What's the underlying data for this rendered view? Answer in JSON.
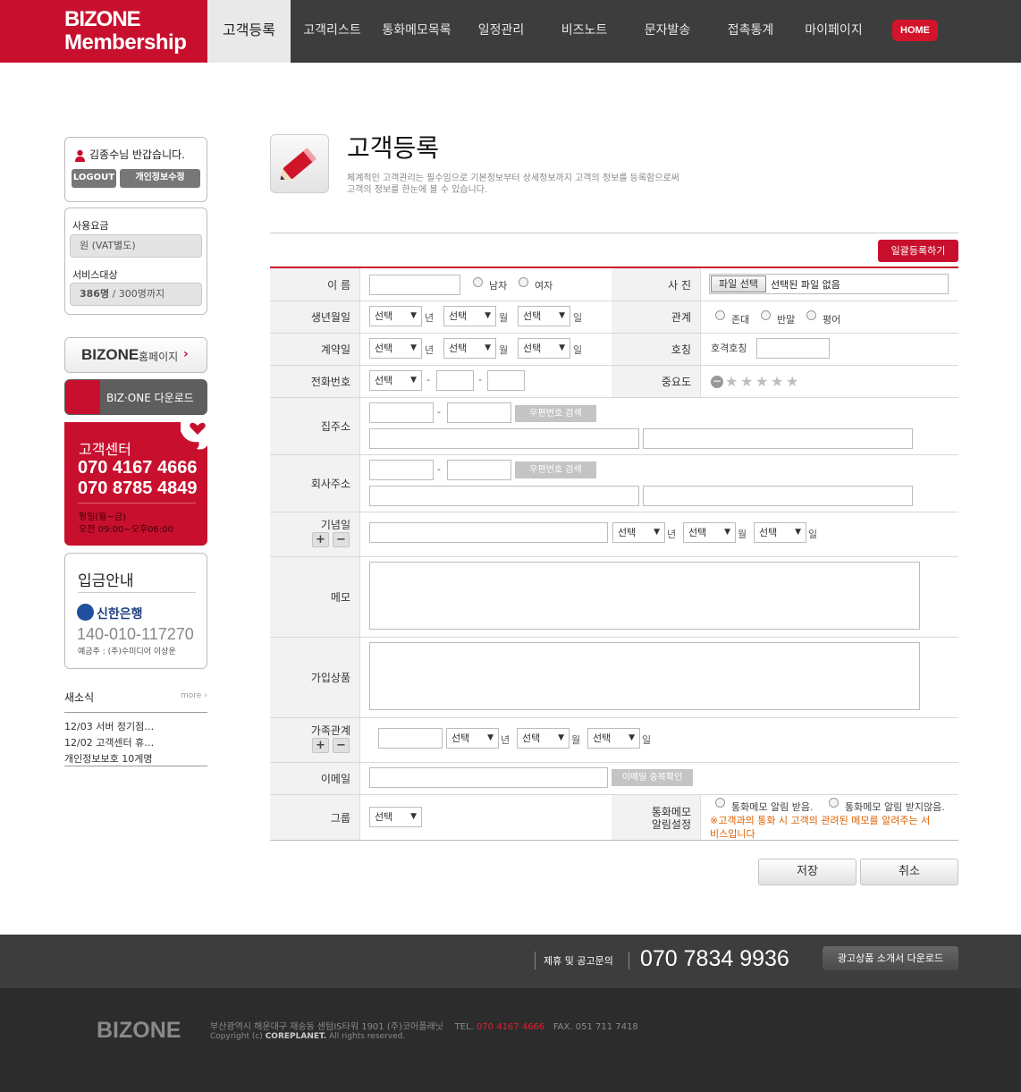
{
  "brand": {
    "logo_top": "BIZONE",
    "logo_bottom": "Membership"
  },
  "nav": {
    "items": [
      "고객등록",
      "고객리스트",
      "통화메모목록",
      "일정관리",
      "비즈노트",
      "문자발송",
      "접촉통계",
      "마이페이지"
    ],
    "home": "HOME"
  },
  "sidebar": {
    "greeting": "김종수님 반갑습니다.",
    "logout": "LOGOUT",
    "edit_profile": "개인정보수정",
    "fee_label": "사용요금",
    "fee_value": "원 (VAT별도)",
    "target_label": "서비스대상",
    "target_count": "386명",
    "target_max": "/ 300명까지",
    "homepage_logo": "BIZONE",
    "homepage_label": "홈페이지",
    "download_label": "BIZ·ONE 다운로드",
    "cc_title": "고객센터",
    "cc_phone1": "070 4167 4666",
    "cc_phone2": "070 8785 4849",
    "cc_hours1": "평일(월~금)",
    "cc_hours2": "오전 09:00~오후06:00",
    "deposit_title": "입금안내",
    "bank_name": "신한은행",
    "account": "140-010-117270",
    "holder": "예금주 : (주)수미디어 이상운",
    "news_title": "새소식",
    "news_more": "more",
    "news": [
      "12/03 서버 정기점…",
      "12/02 고객센터 휴…",
      "개인정보보호 10계명"
    ]
  },
  "page": {
    "title": "고객등록",
    "desc1": "체계적인 고객관리는 필수임으로 기본정보부터 상세정보까지 고객의 정보를 등록함으로써",
    "desc2": "고객의 정보를 한눈에 볼 수 있습니다.",
    "bulk_button": "일괄등록하기"
  },
  "form": {
    "name": "이 름",
    "male": "남자",
    "female": "여자",
    "photo": "사 진",
    "file_button": "파일 선택",
    "file_none": "선택된 파일 없음",
    "birth": "생년월일",
    "select": "선택",
    "year": "년",
    "month": "월",
    "day": "일",
    "relation": "관계",
    "rel1": "존대",
    "rel2": "반말",
    "rel3": "평어",
    "contract": "계약일",
    "title_lbl": "호칭",
    "title_ph": "호격호칭",
    "phone": "전화번호",
    "dash": "-",
    "importance": "중요도",
    "home_addr": "집주소",
    "zip_search": "우편번호 검색",
    "office_addr": "회사주소",
    "anniversary": "기념일",
    "memo": "메모",
    "products": "가입상품",
    "family": "가족관계",
    "email": "이메일",
    "email_check": "이메일 중복확인",
    "group": "그룹",
    "call_memo1": "통화메모",
    "call_memo2": "알림설정",
    "call_opt1": "통화메모 알림 받음.",
    "call_opt2": "통화메모 알림 받지않음.",
    "call_note1": "※고객과의 통화 시 고객의 관려된 메모를 알려주는 서",
    "call_note2": "비스입니다",
    "save": "저장",
    "cancel": "취소"
  },
  "footer": {
    "partner": "제휴 및 공고문의",
    "phone": "070 7834 9936",
    "ad_download": "광고상품 소개서 다운로드",
    "logo": "BIZONE",
    "address": "부산광역시 해운대구 재송동 센텀IS타워 1901 (주)코어플래닛",
    "tel_label": "TEL.",
    "tel": "070 4167 4666",
    "fax": "FAX. 051 711 7418",
    "copyright_pre": "Copyright (c)",
    "copyright_co": "COREPLANET.",
    "copyright_post": "All rights reserved."
  },
  "colors": {
    "brand_red": "#c8102e",
    "nav_dark": "#3d3d3d",
    "footer_dark": "#2c2c2c"
  }
}
